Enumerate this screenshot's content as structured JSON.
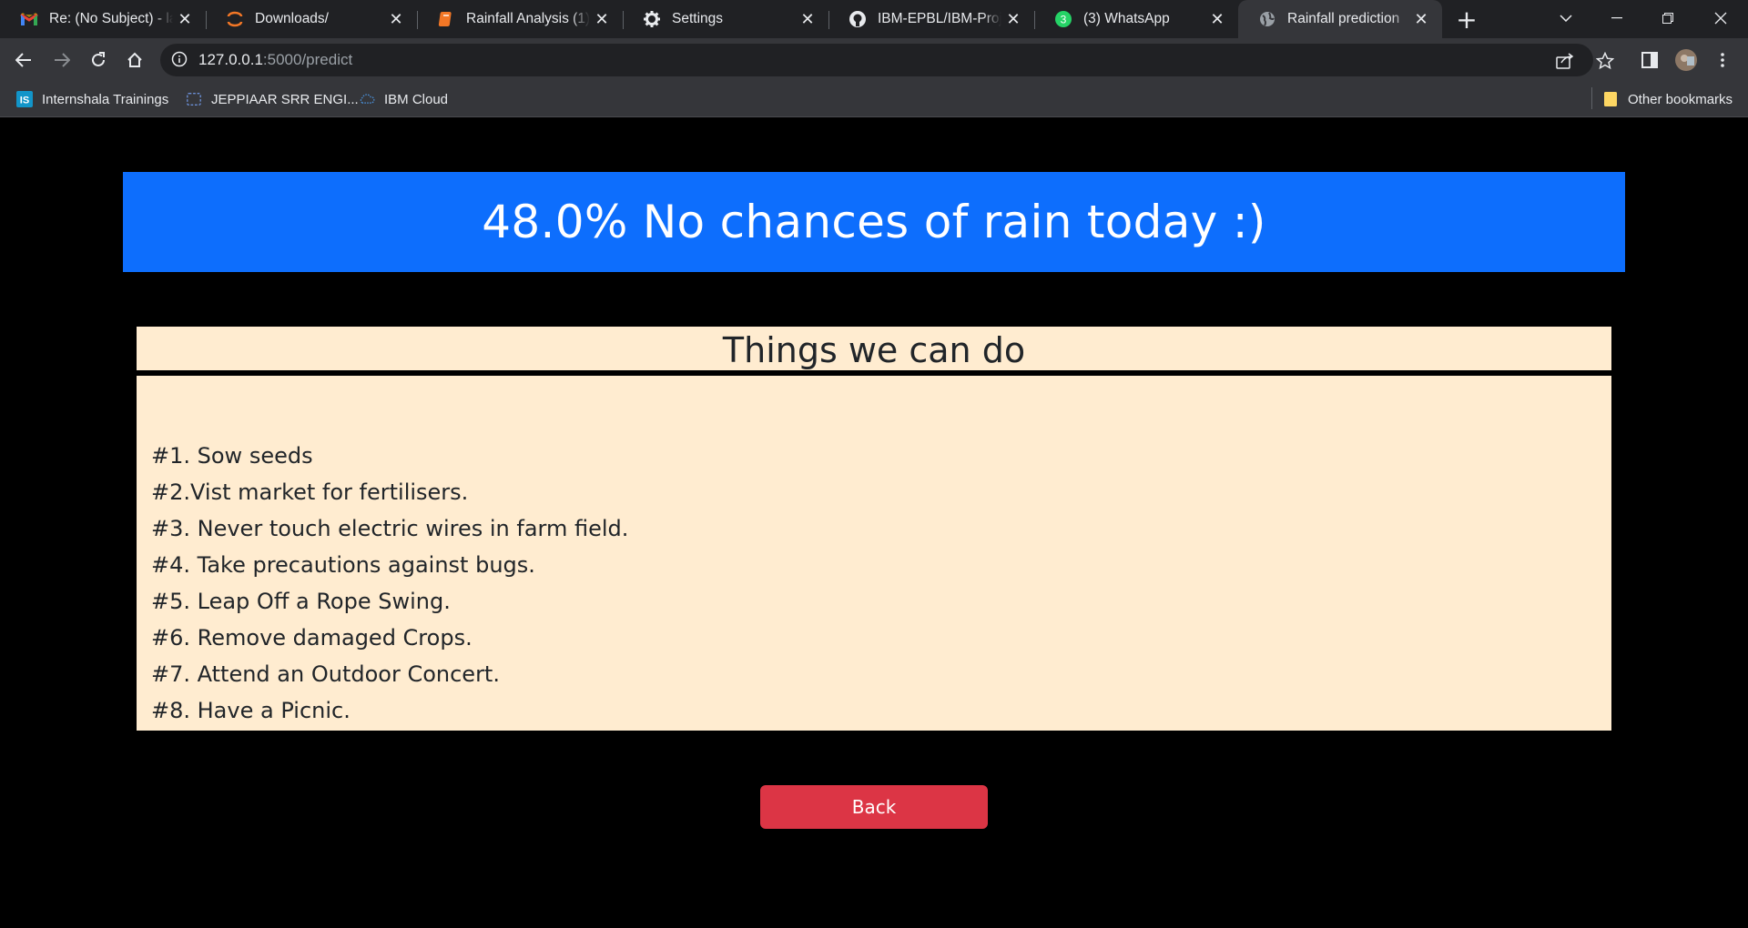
{
  "browser": {
    "tabs": [
      {
        "title": "Re: (No Subject) - laks",
        "icon": "gmail-icon"
      },
      {
        "title": "Downloads/",
        "icon": "jupyter-icon"
      },
      {
        "title": "Rainfall Analysis (1) - J",
        "icon": "notebook-icon"
      },
      {
        "title": "Settings",
        "icon": "gear-icon"
      },
      {
        "title": "IBM-EPBL/IBM-Project",
        "icon": "github-icon"
      },
      {
        "title": "(3) WhatsApp",
        "icon": "whatsapp-icon",
        "badge": "3"
      },
      {
        "title": "Rainfall prediction",
        "icon": "globe-icon",
        "active": true
      }
    ],
    "url_host": "127.0.0.1",
    "url_path": ":5000/predict",
    "bookmarks": [
      {
        "label": "Internshala Trainings",
        "icon": "internshala-icon",
        "badge": "IS"
      },
      {
        "label": "JEPPIAAR SRR ENGI...",
        "icon": "college-icon"
      },
      {
        "label": "IBM Cloud",
        "icon": "ibm-cloud-icon"
      }
    ],
    "other_bookmarks": "Other bookmarks"
  },
  "page": {
    "banner": "48.0% No chances of rain today :)",
    "card_title": "Things we can do",
    "items": [
      "#1. Sow seeds",
      "#2.Vist market for fertilisers.",
      "#3. Never touch electric wires in farm field.",
      "#4. Take precautions against bugs.",
      "#5. Leap Off a Rope Swing.",
      "#6. Remove damaged Crops.",
      "#7. Attend an Outdoor Concert.",
      "#8. Have a Picnic."
    ],
    "back_label": "Back"
  },
  "colors": {
    "banner": "#0d6efd",
    "card": "#ffecd0",
    "back_button": "#dc3545",
    "chrome_dark": "#202124",
    "chrome_toolbar": "#35363a"
  }
}
